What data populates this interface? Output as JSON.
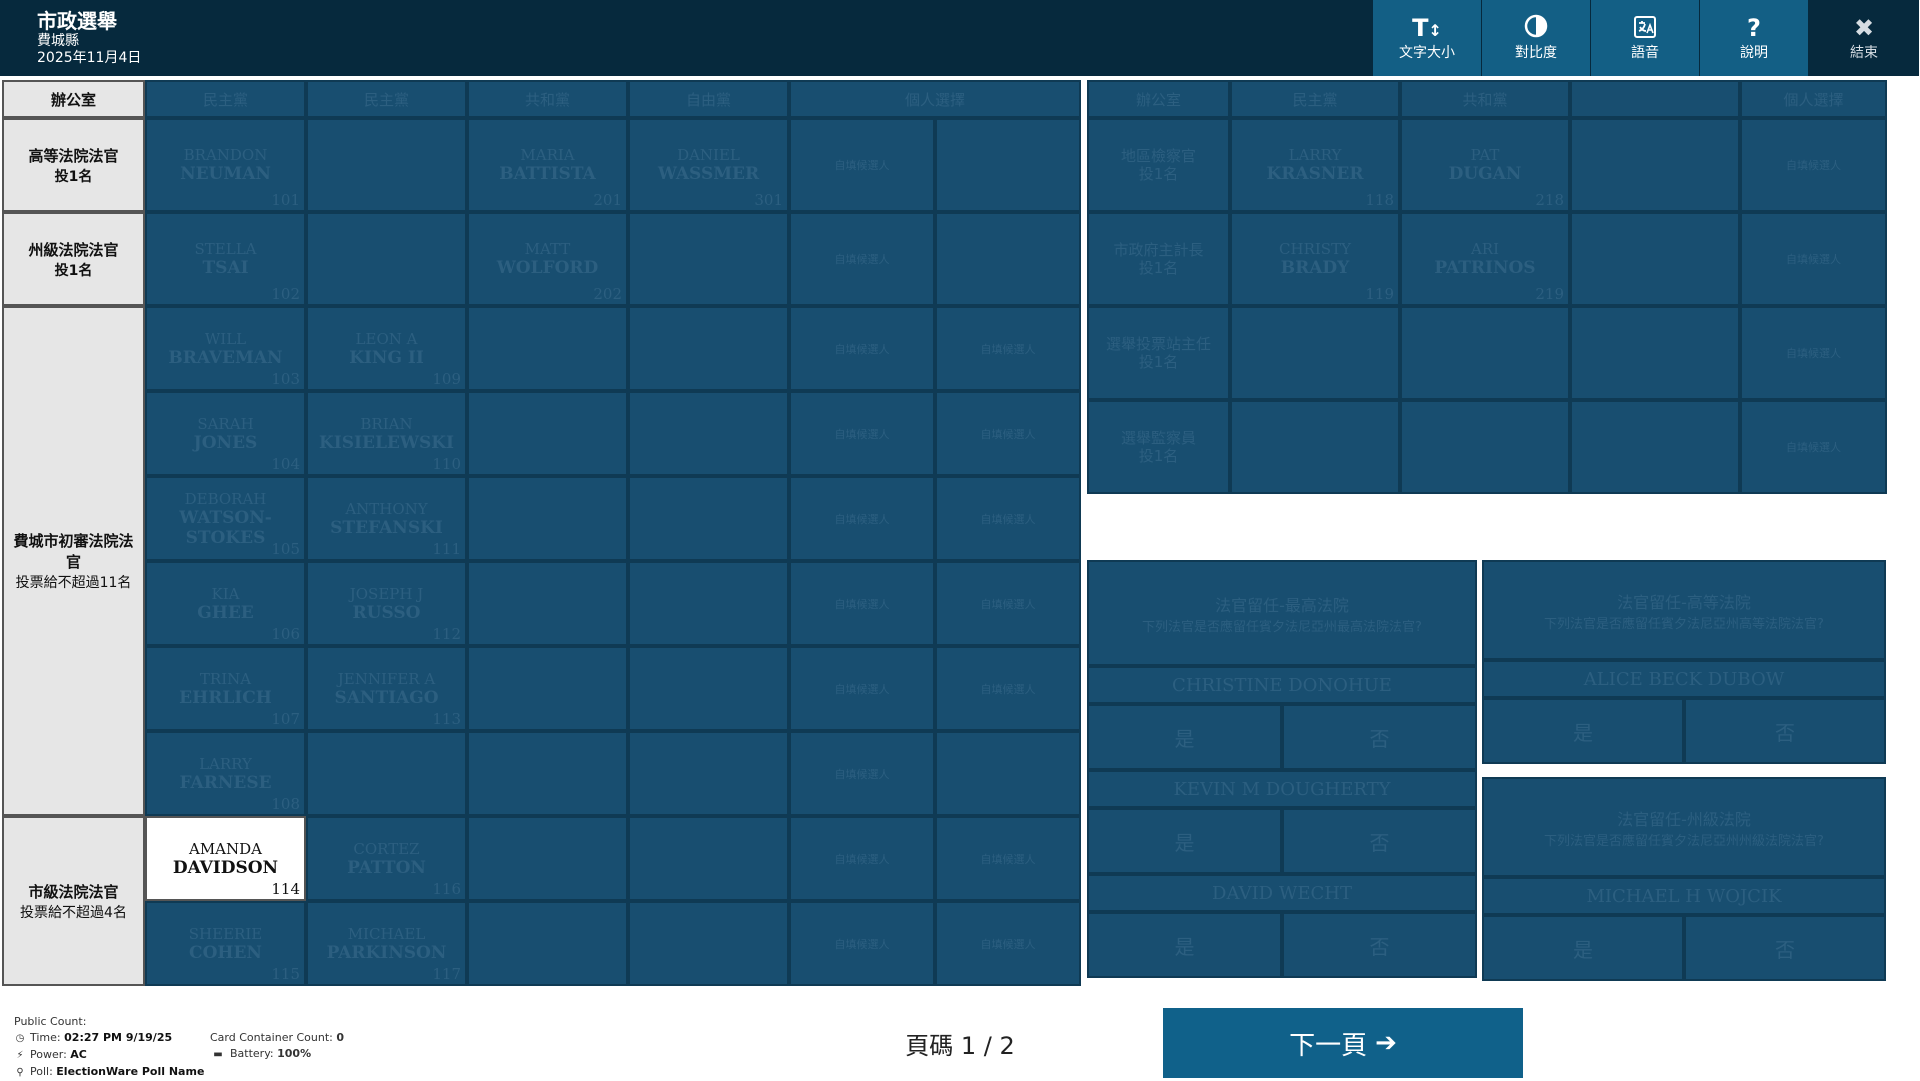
{
  "header": {
    "title": "市政選舉",
    "county": "費城縣",
    "date": "2025年11月4日"
  },
  "tools": [
    {
      "label": "文字大小",
      "icon": "text-size-icon",
      "glyph": "T↕"
    },
    {
      "label": "對比度",
      "icon": "contrast-icon",
      "glyph": "◑"
    },
    {
      "label": "語音",
      "icon": "audio-language-icon",
      "glyph": "語"
    },
    {
      "label": "說明",
      "icon": "help-icon",
      "glyph": "?"
    },
    {
      "label": "結束",
      "icon": "close-icon",
      "glyph": "✖"
    }
  ],
  "left_table": {
    "headers": [
      "辦公室",
      "民主黨",
      "民主黨",
      "共和黨",
      "自由黨",
      "個人選擇"
    ],
    "offices": [
      {
        "name": "高等法院法官",
        "rule": "投1名"
      },
      {
        "name": "州級法院法官",
        "rule": "投1名"
      },
      {
        "name": "費城市初審法院法官",
        "rule": "投票給不超過11名"
      },
      {
        "name": "市級法院法官",
        "rule": "投票給不超過4名"
      }
    ],
    "candidates": {
      "c101": {
        "first": "BRANDON",
        "last": "NEUMAN",
        "num": "101"
      },
      "c201": {
        "first": "MARIA",
        "last": "BATTISTA",
        "num": "201"
      },
      "c301": {
        "first": "DANIEL",
        "last": "WASSMER",
        "num": "301"
      },
      "c102": {
        "first": "STELLA",
        "last": "TSAI",
        "num": "102"
      },
      "c202": {
        "first": "MATT",
        "last": "WOLFORD",
        "num": "202"
      },
      "c103": {
        "first": "WILL",
        "last": "BRAVEMAN",
        "num": "103"
      },
      "c109": {
        "first": "LEON A",
        "last": "KING II",
        "num": "109"
      },
      "c104": {
        "first": "SARAH",
        "last": "JONES",
        "num": "104"
      },
      "c110": {
        "first": "BRIAN",
        "last": "KISIELEWSKI",
        "num": "110"
      },
      "c105": {
        "first": "DEBORAH",
        "last": "WATSON-STOKES",
        "num": "105"
      },
      "c111": {
        "first": "ANTHONY",
        "last": "STEFANSKI",
        "num": "111"
      },
      "c106": {
        "first": "KIA",
        "last": "GHEE",
        "num": "106"
      },
      "c112": {
        "first": "JOSEPH J",
        "last": "RUSSO",
        "num": "112"
      },
      "c107": {
        "first": "TRINA",
        "last": "EHRLICH",
        "num": "107"
      },
      "c113": {
        "first": "JENNIFER A",
        "last": "SANTIAGO",
        "num": "113"
      },
      "c108": {
        "first": "LARRY",
        "last": "FARNESE",
        "num": "108"
      },
      "c114": {
        "first": "AMANDA",
        "last": "DAVIDSON",
        "num": "114"
      },
      "c116": {
        "first": "CORTEZ",
        "last": "PATTON",
        "num": "116"
      },
      "c115": {
        "first": "SHEERIE",
        "last": "COHEN",
        "num": "115"
      },
      "c117": {
        "first": "MICHAEL",
        "last": "PARKINSON",
        "num": "117"
      }
    },
    "writein_label": "自填候選人"
  },
  "right_table": {
    "headers": [
      "辦公室",
      "民主黨",
      "共和黨",
      "",
      "個人選擇"
    ],
    "offices": [
      {
        "name": "地區檢察官",
        "rule": "投1名"
      },
      {
        "name": "市政府主計長",
        "rule": "投1名"
      },
      {
        "name": "選舉投票站主任",
        "rule": "投1名"
      },
      {
        "name": "選舉監察員",
        "rule": "投1名"
      }
    ],
    "candidates": {
      "c118": {
        "first": "LARRY",
        "last": "KRASNER",
        "num": "118"
      },
      "c218": {
        "first": "PAT",
        "last": "DUGAN",
        "num": "218"
      },
      "c119": {
        "first": "CHRISTY",
        "last": "BRADY",
        "num": "119"
      },
      "c219": {
        "first": "ARI",
        "last": "PATRINOS",
        "num": "219"
      }
    }
  },
  "retention": {
    "supreme": {
      "title": "法官留任-最高法院",
      "question": "下列法官是否應留任賓夕法尼亞州最高法院法官?",
      "judges": [
        "CHRISTINE DONOHUE",
        "KEVIN M DOUGHERTY",
        "DAVID WECHT"
      ]
    },
    "superior": {
      "title": "法官留任-高等法院",
      "question": "下列法官是否應留任賓夕法尼亞州高等法院法官?",
      "judges": [
        "ALICE BECK DUBOW"
      ]
    },
    "commonwealth": {
      "title": "法官留任-州級法院",
      "question": "下列法官是否應留任賓夕法尼亞州州級法院法官?",
      "judges": [
        "MICHAEL H WOJCIK"
      ]
    },
    "yes": "是",
    "no": "否"
  },
  "footer": {
    "public_count_label": "Public Count:",
    "time_label": "Time:",
    "time_value": "02:27 PM 9/19/25",
    "power_label": "Power:",
    "power_value": "AC",
    "poll_label": "Poll:",
    "poll_value": "ElectionWare Poll Name",
    "card_label": "Card Container Count:",
    "card_value": "0",
    "battery_label": "Battery:",
    "battery_value": "100%",
    "page_indicator": "頁碼 1 / 2",
    "next_label": "下一頁"
  }
}
